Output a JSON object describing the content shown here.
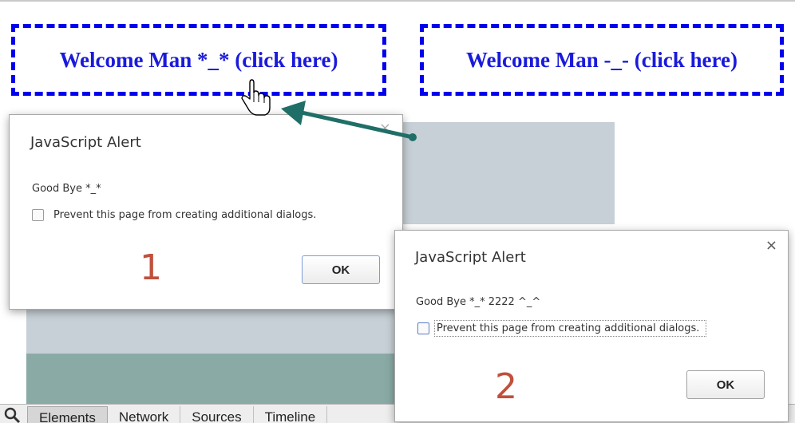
{
  "welcome": [
    {
      "text": "Welcome Man *_* (click here)"
    },
    {
      "text": "Welcome Man -_- (click here)"
    }
  ],
  "devtools": {
    "tabs": [
      "Elements",
      "Network",
      "Sources",
      "Timeline"
    ]
  },
  "dialogs": [
    {
      "title": "JavaScript Alert",
      "message": "Good Bye *_*",
      "checkbox_label": "Prevent this page from creating additional dialogs.",
      "ok_label": "OK",
      "number": "1",
      "close_icon": "×"
    },
    {
      "title": "JavaScript Alert",
      "message": "Good Bye *_* 2222 ^_^",
      "checkbox_label": "Prevent this page from creating additional dialogs.",
      "ok_label": "OK",
      "number": "2",
      "close_icon": "×"
    }
  ],
  "colors": {
    "link_blue": "#1a1adb",
    "dash_border": "#0000ee",
    "annotation_number": "#c0503c",
    "arrow": "#1f6e67"
  },
  "icons": [
    "search-icon",
    "hand-cursor-icon",
    "annotation-arrow",
    "close-icon"
  ]
}
